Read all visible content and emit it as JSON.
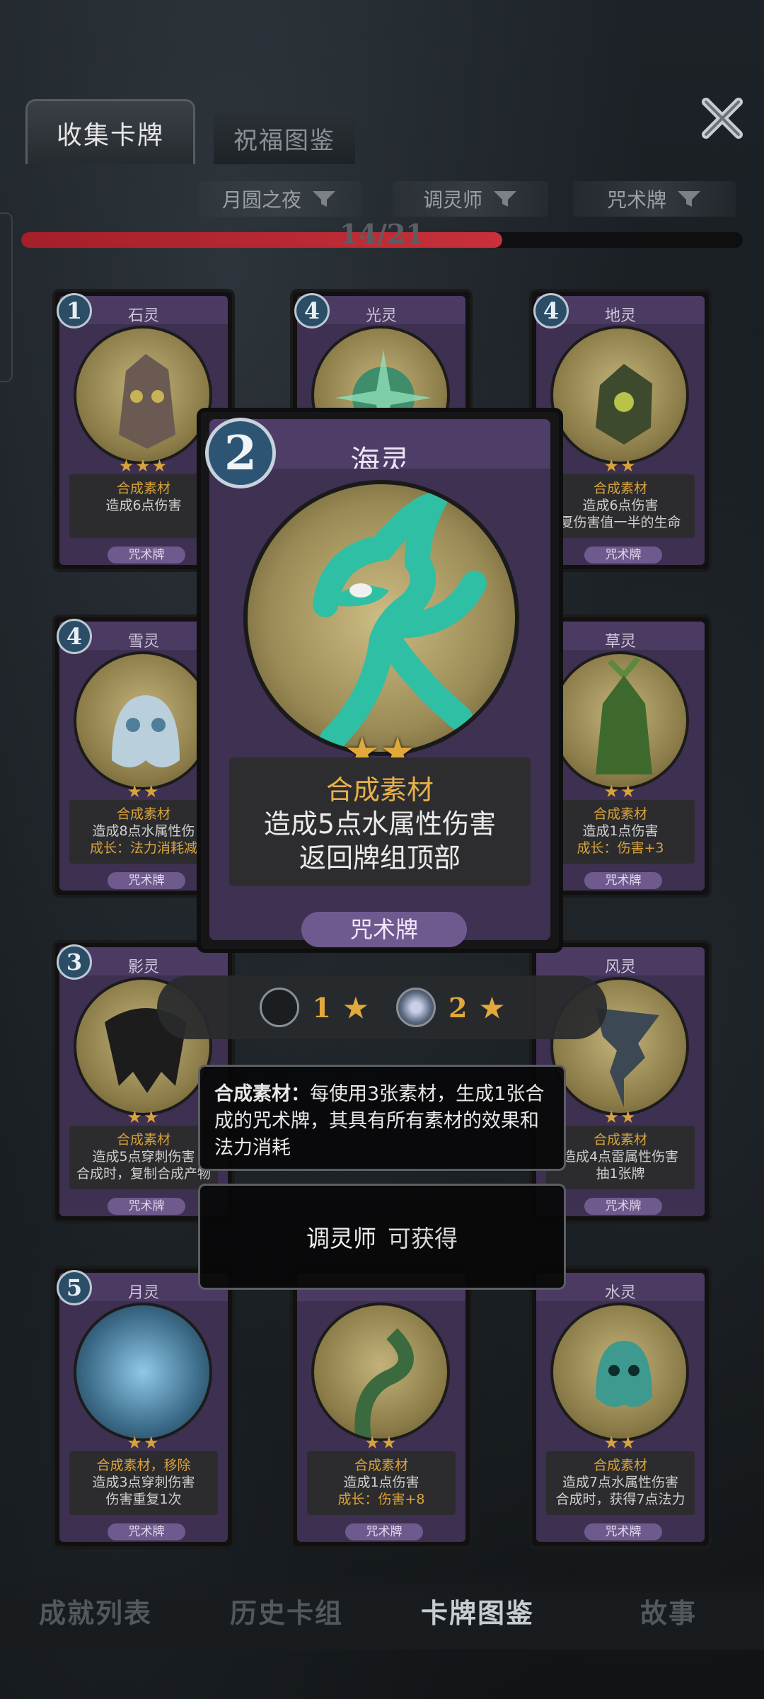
{
  "tabs": {
    "collect": "收集卡牌",
    "bless": "祝福图鉴"
  },
  "filters": [
    {
      "label": "月圆之夜"
    },
    {
      "label": "调灵师"
    },
    {
      "label": "咒术牌"
    }
  ],
  "progress": {
    "text": "14/21",
    "current": 14,
    "total": 21
  },
  "cards": [
    {
      "cost": "1",
      "name": "石灵",
      "stars": "★★★",
      "line1": "合成素材",
      "line2": "造成6点伤害",
      "line3": "",
      "type": "咒术牌",
      "art_color": "#6b5a52"
    },
    {
      "cost": "4",
      "name": "光灵",
      "stars": "",
      "line1": "",
      "line2": "",
      "line3": "",
      "type": "",
      "art_color": "#3f8d6a"
    },
    {
      "cost": "4",
      "name": "地灵",
      "stars": "★★",
      "line1": "合成素材",
      "line2": "造成6点伤害",
      "line3": "夏伤害值一半的生命",
      "type": "咒术牌",
      "art_color": "#3e4a2e"
    },
    {
      "cost": "4",
      "name": "雪灵",
      "stars": "★★",
      "line1": "合成素材",
      "line2": "造成8点水属性伤",
      "line3": "成长：法力消耗减",
      "type": "咒术牌",
      "art_color": "#9ab7c9"
    },
    {
      "cost": "",
      "name": "草灵",
      "stars": "★★",
      "line1": "合成素材",
      "line2": "造成1点伤害",
      "line3": "成长：伤害+3",
      "type": "咒术牌",
      "art_color": "#3d6a2c"
    },
    {
      "cost": "3",
      "name": "影灵",
      "stars": "★★",
      "line1": "合成素材",
      "line2": "造成5点穿刺伤害",
      "line3": "合成时，复制合成产物",
      "type": "咒术牌",
      "art_color": "#2a2a2a"
    },
    {
      "cost": "",
      "name": "风灵",
      "stars": "★★",
      "line1": "合成素材",
      "line2": "造成4点雷属性伤害",
      "line3": "抽1张牌",
      "type": "咒术牌",
      "art_color": "#3c4854"
    },
    {
      "cost": "5",
      "name": "月灵",
      "stars": "★★",
      "line1": "合成素材，移除",
      "line2": "造成3点穿刺伤害",
      "line3": "伤害重复1次",
      "type": "咒术牌",
      "art_color": "#3c6c8a"
    },
    {
      "cost": "",
      "name": "",
      "stars": "★★",
      "line1": "合成素材",
      "line2": "造成1点伤害",
      "line3": "成长：伤害+8",
      "type": "咒术牌",
      "art_color": "#3b6a3f"
    },
    {
      "cost": "",
      "name": "水灵",
      "stars": "★★",
      "line1": "合成素材",
      "line2": "造成7点水属性伤害",
      "line3": "合成时，获得7点法力",
      "type": "咒术牌",
      "art_color": "#3e9a8e"
    }
  ],
  "featured": {
    "cost": "2",
    "name": "海灵",
    "stars": "★★",
    "line1": "合成素材",
    "line2": "造成5点水属性伤害",
    "line3": "返回牌组顶部",
    "type": "咒术牌"
  },
  "levels": [
    {
      "value": "1",
      "star": "★"
    },
    {
      "value": "2",
      "star": "★"
    }
  ],
  "info_panel": {
    "term": "合成素材：",
    "text": "每使用3张素材，生成1张合成的咒术牌，其具有所有素材的效果和法力消耗"
  },
  "source_panel": {
    "source": "调灵师",
    "obtain": "可获得"
  },
  "bottom_nav": [
    {
      "label": "成就列表",
      "active": false
    },
    {
      "label": "历史卡组",
      "active": false
    },
    {
      "label": "卡牌图鉴",
      "active": true
    },
    {
      "label": "故事",
      "active": false
    }
  ]
}
